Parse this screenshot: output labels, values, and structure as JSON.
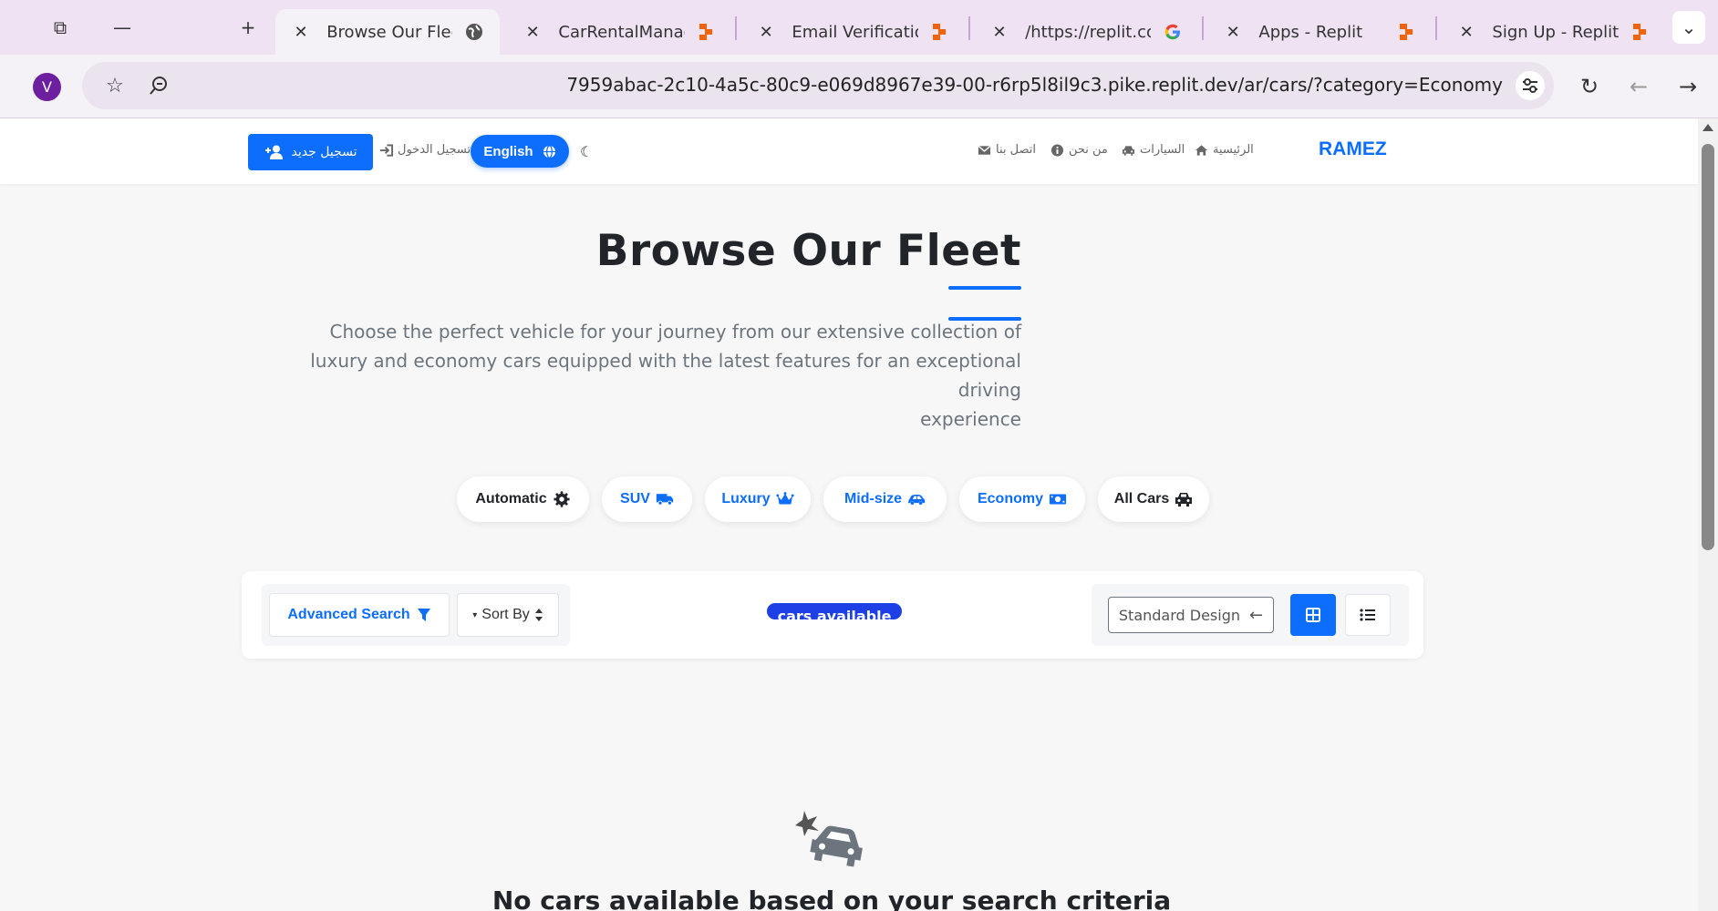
{
  "browser": {
    "tabs": [
      {
        "title": "Browse Our Fleet",
        "active": true
      },
      {
        "title": "CarRentalManager",
        "active": false
      },
      {
        "title": "Email Verification -",
        "active": false
      },
      {
        "title": "/https://replit.com/",
        "active": false
      },
      {
        "title": "Apps - Replit",
        "active": false
      },
      {
        "title": "Sign Up - Replit",
        "active": false
      }
    ],
    "profile_initial": "V",
    "url": "7959abac-2c10-4a5c-80c9-e069d8967e39-00-r6rp5l8il9c3.pike.replit.dev/ar/cars/?category=Economy"
  },
  "navbar": {
    "brand": "RAMEZ",
    "links": {
      "home": "الرئيسية",
      "cars": "السيارات",
      "about": "من نحن",
      "contact": "اتصل بنا"
    },
    "language_button": "English",
    "login": "تسجيل الدخول",
    "register": "تسجيل جديد"
  },
  "hero": {
    "title": "Browse Our Fleet",
    "subtitle_lines": [
      "Choose the perfect vehicle for your journey from our extensive collection of",
      "luxury and economy cars equipped with the latest features for an exceptional driving",
      "experience"
    ]
  },
  "categories": [
    {
      "label": "All Cars",
      "icon": "car-icon",
      "color": "#212529"
    },
    {
      "label": "Economy",
      "icon": "money-icon",
      "color": "#0d6efd"
    },
    {
      "label": "Mid-size",
      "icon": "car-side-icon",
      "color": "#0d6efd"
    },
    {
      "label": "Luxury",
      "icon": "crown-icon",
      "color": "#0d6efd"
    },
    {
      "label": "SUV",
      "icon": "truck-icon",
      "color": "#0d6efd"
    },
    {
      "label": "Automatic",
      "icon": "gear-icon",
      "color": "#212529"
    }
  ],
  "controls": {
    "advanced_search": "Advanced Search",
    "sort_by": "Sort By",
    "cars_available": "cars available",
    "standard_design": "Standard Design"
  },
  "empty_state": {
    "message": "No cars available based on your search criteria",
    "icon": "car-crash-icon"
  },
  "colors": {
    "primary": "#0d6efd",
    "dark": "#212529",
    "muted": "#6c757d"
  }
}
